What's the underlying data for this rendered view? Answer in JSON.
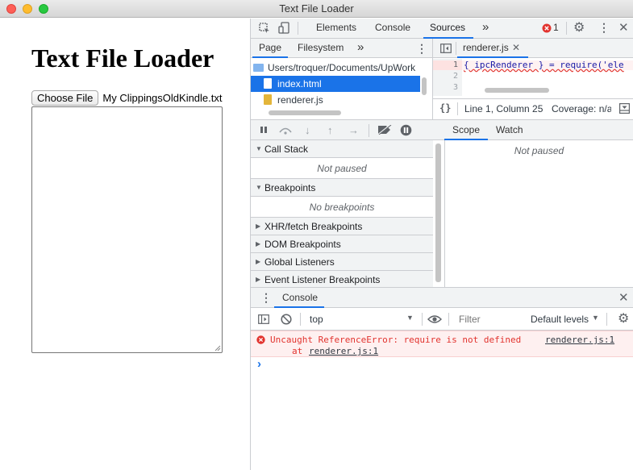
{
  "window": {
    "title": "Text File Loader"
  },
  "page": {
    "heading": "Text File Loader",
    "file_button": "Choose File",
    "file_name": "My ClippingsOldKindle.txt"
  },
  "devtools": {
    "tabs": [
      "Elements",
      "Console",
      "Sources"
    ],
    "more_tabs": "»",
    "error_count": "1",
    "navigator": {
      "tabs": [
        "Page",
        "Filesystem"
      ],
      "more": "»",
      "folder": "Users/troquer/Documents/UpWork",
      "files": [
        "index.html",
        "renderer.js"
      ]
    },
    "editor": {
      "file_tab": "renderer.js",
      "line_numbers": [
        "1",
        "2",
        "3"
      ],
      "code_line_1": "{ ipcRenderer } = require('ele",
      "status_position": "Line 1, Column 25",
      "status_coverage": "Coverage: n/a",
      "format_icon": "{}"
    },
    "debugger": {
      "sections": {
        "call_stack": "Call Stack",
        "call_stack_body": "Not paused",
        "breakpoints": "Breakpoints",
        "breakpoints_body": "No breakpoints",
        "xhr": "XHR/fetch Breakpoints",
        "dom": "DOM Breakpoints",
        "global": "Global Listeners",
        "event": "Event Listener Breakpoints"
      },
      "scope_tab": "Scope",
      "watch_tab": "Watch",
      "scope_body": "Not paused"
    },
    "console": {
      "drawer_title": "Console",
      "context": "top",
      "filter_placeholder": "Filter",
      "levels": "Default levels",
      "error_message": "Uncaught ReferenceError: require is not defined",
      "error_source": "renderer.js:1",
      "error_at_prefix": "at ",
      "error_at_link": "renderer.js:1",
      "prompt": "›"
    }
  },
  "colors": {
    "accent": "#1a73e8",
    "error": "#e2332e",
    "error_bg": "#fef0f0"
  }
}
